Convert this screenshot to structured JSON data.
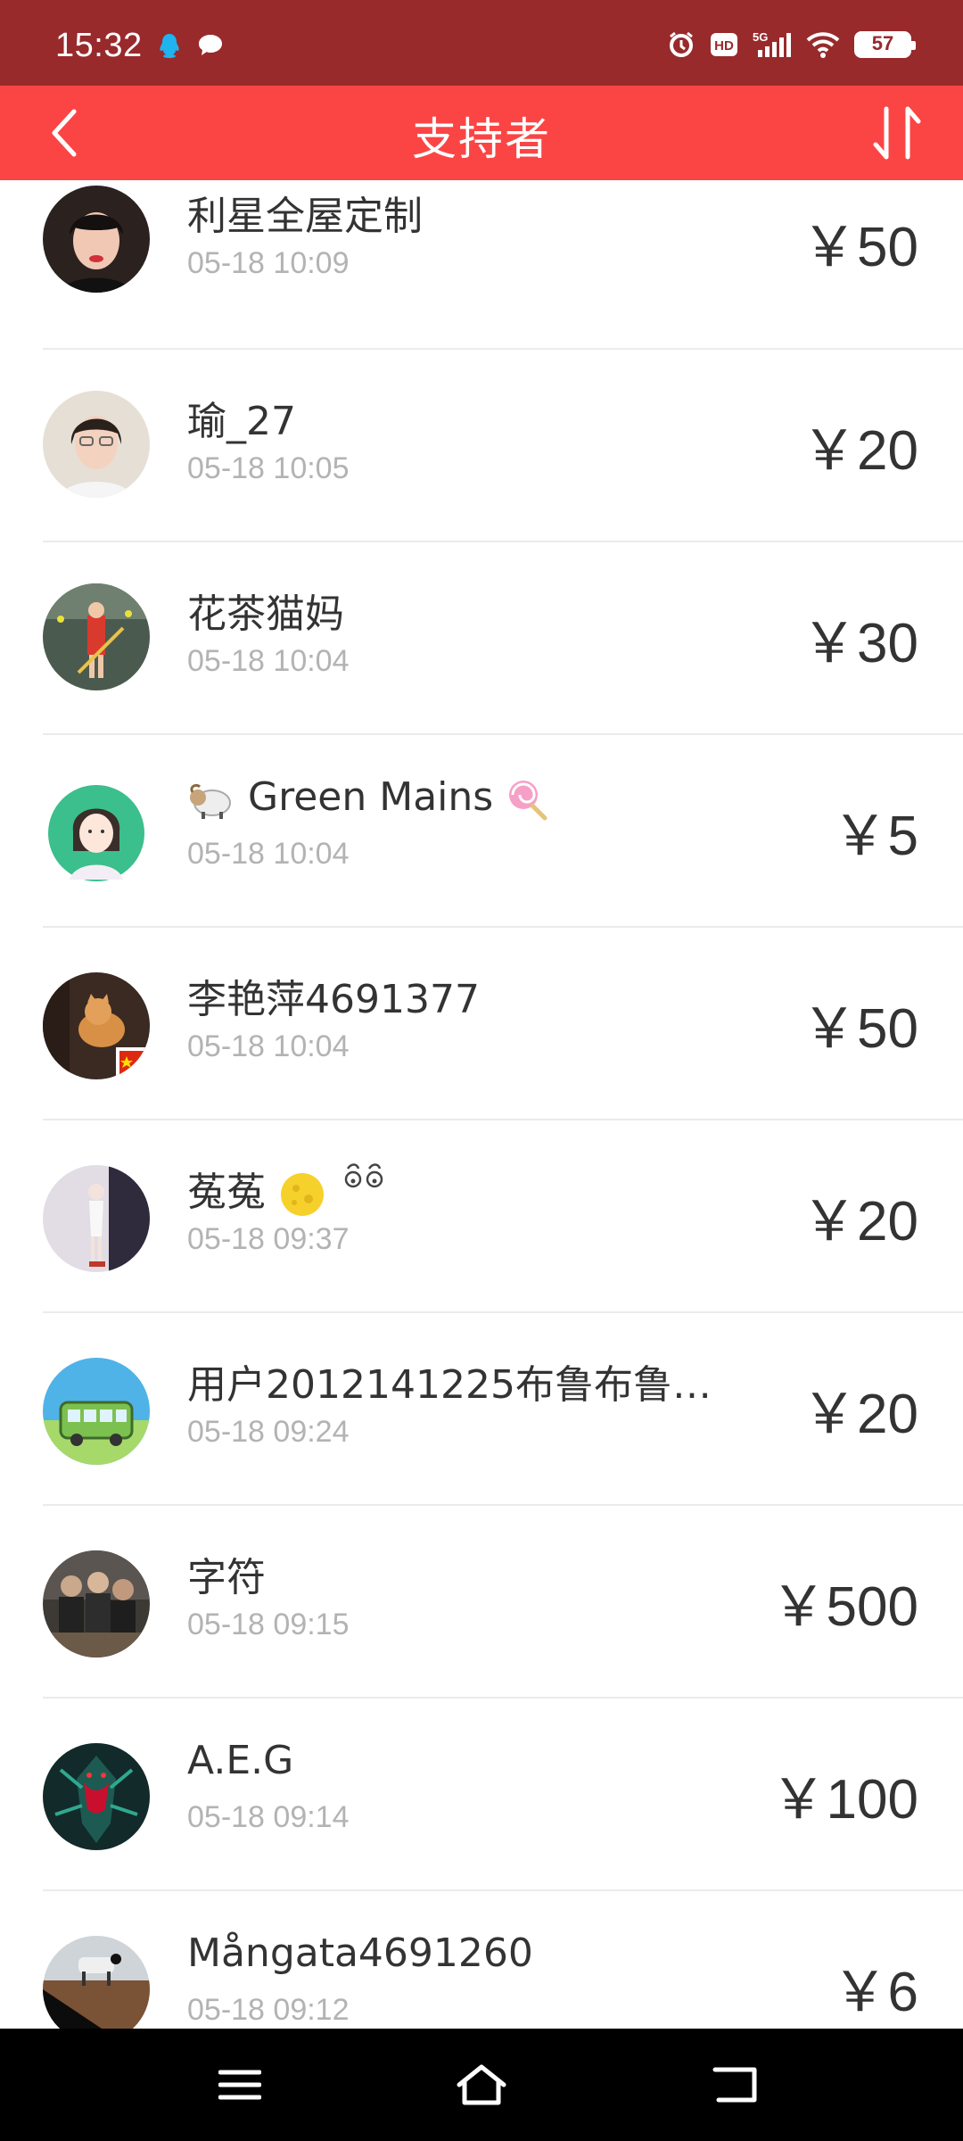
{
  "status_bar": {
    "time": "15:32",
    "battery": "57",
    "icons": [
      "qq-icon",
      "message-bubble-icon",
      "alarm-icon",
      "hd-icon",
      "5g-signal-icon",
      "wifi-icon",
      "battery-icon"
    ]
  },
  "header": {
    "title": "支持者",
    "back_icon": "chevron-left-icon",
    "sort_icon": "sort-arrows-icon"
  },
  "colors": {
    "status_bar_bg": "#982a2c",
    "header_bg": "#fb4545",
    "name_text": "#333333",
    "time_text": "#b3b3b3",
    "divider": "#ebebeb"
  },
  "supporters": [
    {
      "name": "利星全屋定制",
      "time": "05-18 10:09",
      "amount": "￥50"
    },
    {
      "name": "瑜_27",
      "time": "05-18 10:05",
      "amount": "￥20"
    },
    {
      "name": "花茶猫妈",
      "time": "05-18 10:04",
      "amount": "￥30"
    },
    {
      "name": "Green Mains",
      "time": "05-18 10:04",
      "amount": "￥5"
    },
    {
      "name": "李艳萍4691377",
      "time": "05-18 10:04",
      "amount": "￥50"
    },
    {
      "name": "菟菟",
      "time": "05-18 09:37",
      "amount": "￥20"
    },
    {
      "name": "用户2012141225布鲁布鲁…",
      "time": "05-18 09:24",
      "amount": "￥20"
    },
    {
      "name": "字符",
      "time": "05-18 09:15",
      "amount": "￥500"
    },
    {
      "name": "A.E.G",
      "time": "05-18 09:14",
      "amount": "￥100"
    },
    {
      "name": "Mångata4691260",
      "time": "05-18 09:12",
      "amount": "￥6"
    }
  ],
  "nav": {
    "icons": [
      "menu-icon",
      "home-icon",
      "back-icon"
    ]
  }
}
